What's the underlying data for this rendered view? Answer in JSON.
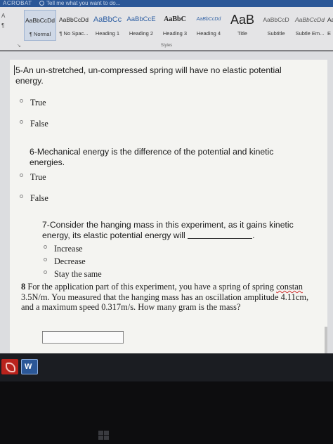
{
  "titlebar": {
    "app": "ACROBAT",
    "tell_me": "Tell me what you want to do..."
  },
  "ribbon": {
    "left_tools": [
      "A",
      "¶"
    ],
    "styles": [
      {
        "sample": "AaBbCcDd",
        "name": "¶ Normal",
        "selected": true
      },
      {
        "sample": "AaBbCcDd",
        "name": "¶ No Spac...",
        "selected": false
      },
      {
        "sample": "AaBbCc",
        "name": "Heading 1",
        "selected": false
      },
      {
        "sample": "AaBbCcE",
        "name": "Heading 2",
        "selected": false
      },
      {
        "sample": "AaBbC",
        "name": "Heading 3",
        "selected": false
      },
      {
        "sample": "AaBbCcDd",
        "name": "Heading 4",
        "selected": false
      },
      {
        "sample": "AaB",
        "name": "Title",
        "selected": false
      },
      {
        "sample": "AaBbCcD",
        "name": "Subtitle",
        "selected": false
      },
      {
        "sample": "AaBbCcDd",
        "name": "Subtle Em...",
        "selected": false
      },
      {
        "sample": "Aa",
        "name": "E",
        "selected": false
      }
    ],
    "group_label": "Styles",
    "launcher": "↘"
  },
  "questions": {
    "q5": {
      "text": "5-An un-stretched, un-compressed spring will have no elastic potential energy.",
      "options": [
        "True",
        "False"
      ]
    },
    "q6": {
      "text": "6-Mechanical energy is the difference of the potential and kinetic energies.",
      "options": [
        "True",
        "False"
      ]
    },
    "q7": {
      "text_before": "7-Consider the hanging mass in this experiment, as it gains kinetic energy, its elastic potential energy will",
      "text_after": ".",
      "options": [
        "Increase",
        "Decrease",
        "Stay the same"
      ]
    },
    "q8": {
      "number": "8",
      "text_a": "For the application part of this experiment, you have a spring of spring",
      "squiggle_word": "constan",
      "text_b": "3.5N/m. You measured that the hanging mass has an oscillation amplitude 4.11cm, and a maximum speed 0.317m/s. How many gram is the mass?",
      "answer": ""
    }
  },
  "taskbar": {
    "word_label": "W"
  },
  "colors": {
    "ribbon_bg": "#e4e4e6",
    "titlebar_bg": "#2b5797",
    "page_bg": "#f4f4f1",
    "acrobat_red": "#b9221c",
    "word_blue": "#2b5797"
  }
}
